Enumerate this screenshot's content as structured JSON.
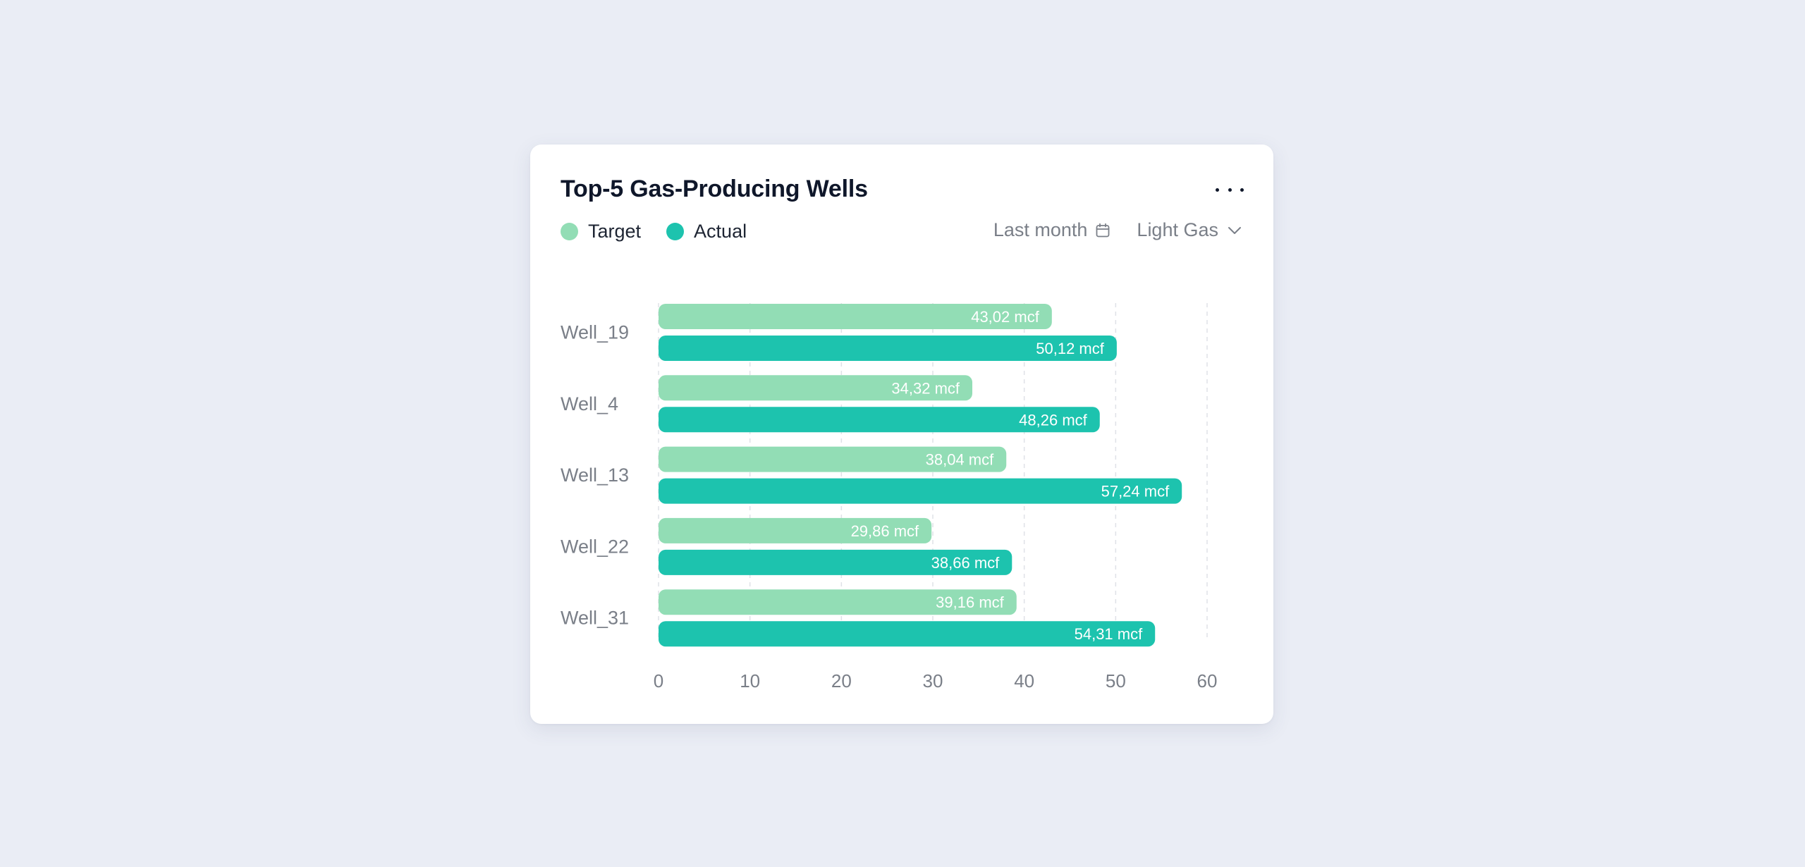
{
  "card": {
    "title": "Top-5 Gas-Producing Wells",
    "more_icon": "more-horizontal-icon",
    "legend": [
      {
        "label": "Target",
        "color": "#92ddb5"
      },
      {
        "label": "Actual",
        "color": "#1dc3ae"
      }
    ],
    "filters": {
      "period": {
        "label": "Last month",
        "icon": "calendar-icon"
      },
      "gas_type": {
        "label": "Light Gas",
        "icon": "chevron-down-icon"
      }
    }
  },
  "chart_data": {
    "type": "bar",
    "orientation": "horizontal",
    "title": "Top-5 Gas-Producing Wells",
    "categories": [
      "Well_19",
      "Well_4",
      "Well_13",
      "Well_22",
      "Well_31"
    ],
    "series": [
      {
        "name": "Target",
        "color": "#92ddb5",
        "values": [
          43.02,
          34.32,
          38.04,
          29.86,
          39.16
        ],
        "labels": [
          "43,02 mcf",
          "34,32 mcf",
          "38,04 mcf",
          "29,86 mcf",
          "39,16 mcf"
        ]
      },
      {
        "name": "Actual",
        "color": "#1dc3ae",
        "values": [
          50.12,
          48.26,
          57.24,
          38.66,
          54.31
        ],
        "labels": [
          "50,12 mcf",
          "48,26 mcf",
          "57,24 mcf",
          "38,66 mcf",
          "54,31 mcf"
        ]
      }
    ],
    "unit": "mcf",
    "xlabel": "",
    "ylabel": "",
    "xlim": [
      0,
      60
    ],
    "xticks": [
      0,
      10,
      20,
      30,
      40,
      50,
      60
    ],
    "xtick_labels": [
      "0",
      "10",
      "20",
      "30",
      "40",
      "50",
      "60"
    ],
    "grid": "vertical-dashed",
    "legend_position": "top-left"
  }
}
